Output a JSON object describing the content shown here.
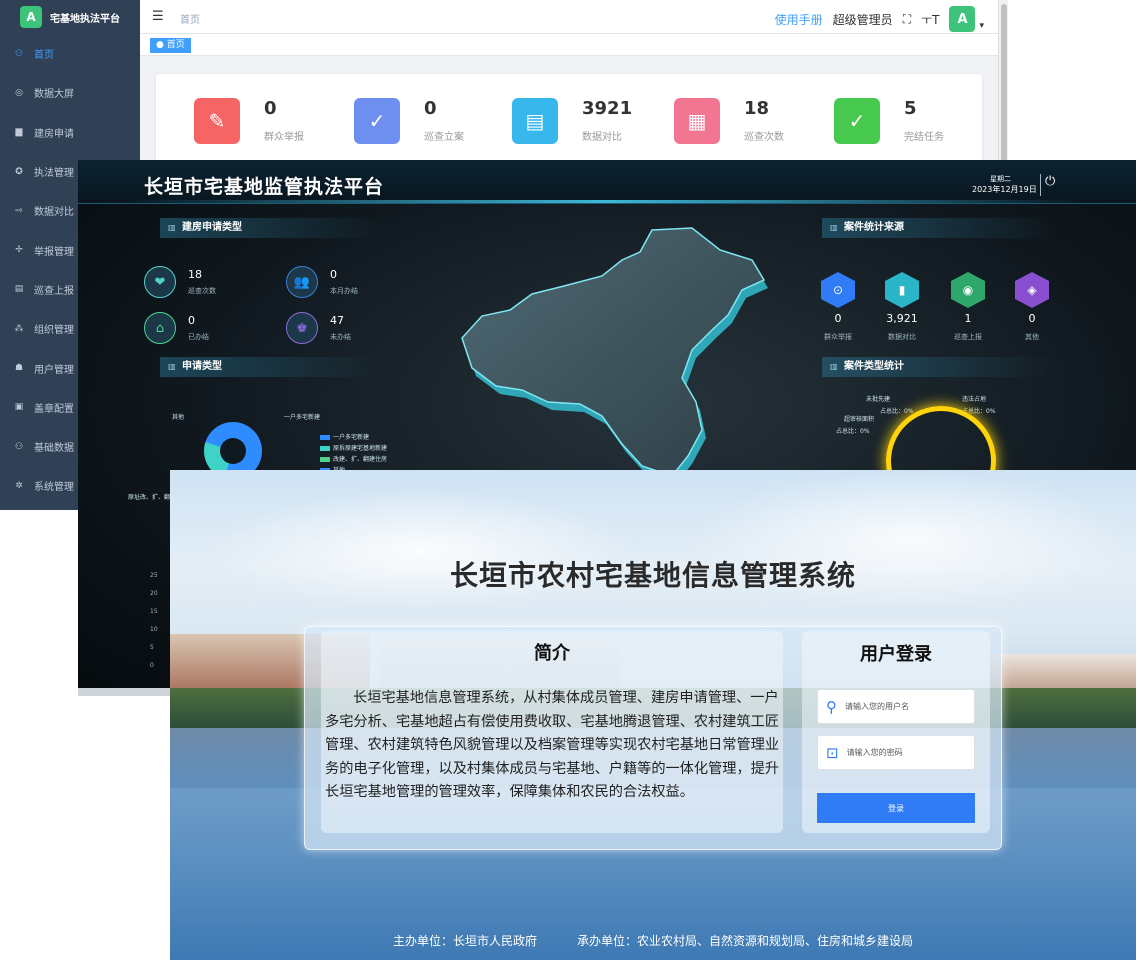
{
  "admin": {
    "logo_char": "A",
    "platform_title": "宅基地执法平台",
    "menu": [
      {
        "icon": "⚇",
        "label": "首页"
      },
      {
        "icon": "◎",
        "label": "数据大屏"
      },
      {
        "icon": "▆",
        "label": "建房申请"
      },
      {
        "icon": "✪",
        "label": "执法管理"
      },
      {
        "icon": "⇨",
        "label": "数据对比"
      },
      {
        "icon": "✢",
        "label": "举报管理"
      },
      {
        "icon": "▤",
        "label": "巡查上报"
      },
      {
        "icon": "⁂",
        "label": "组织管理"
      },
      {
        "icon": "☗",
        "label": "用户管理"
      },
      {
        "icon": "▣",
        "label": "盖章配置"
      },
      {
        "icon": "⚇",
        "label": "基础数据"
      },
      {
        "icon": "✲",
        "label": "系统管理"
      }
    ],
    "breadcrumb": "首页",
    "tag_home": "● 首页",
    "manual_link": "使用手册",
    "user_name": "超级管理员",
    "fullscreen_icon": "⛶",
    "fontsize_icon": "ㅜT",
    "avatar_char": "A",
    "dropdown_icon": "▾",
    "hamburger_icon": "☰",
    "stats": [
      {
        "value": "0",
        "label": "群众举报",
        "color": "#f56565",
        "icon": "✎"
      },
      {
        "value": "0",
        "label": "巡查立案",
        "color": "#6e8ef0",
        "icon": "✓"
      },
      {
        "value": "3921",
        "label": "数据对比",
        "color": "#37b7ec",
        "icon": "▤"
      },
      {
        "value": "18",
        "label": "巡查次数",
        "color": "#f27591",
        "icon": "▦"
      },
      {
        "value": "5",
        "label": "完结任务",
        "color": "#47c84f",
        "icon": "✓"
      }
    ]
  },
  "dashboard": {
    "title": "长垣市宅基地监管执法平台",
    "weekday": "星期二",
    "date": "2023年12月19日",
    "power_icon": "⏻",
    "panel_build_type": "建房申请类型",
    "kpis": [
      {
        "value": "18",
        "label": "巡查次数",
        "color": "#4fd3c9",
        "icon": "❤"
      },
      {
        "value": "0",
        "label": "本月办结",
        "color": "#3a7fd9",
        "icon": "👥"
      },
      {
        "value": "0",
        "label": "已办结",
        "color": "#4fd38a",
        "icon": "⌂"
      },
      {
        "value": "47",
        "label": "未办结",
        "color": "#8b6ad9",
        "icon": "♚"
      }
    ],
    "panel_apply_type": "申请类型",
    "donut_label_left": "其他",
    "donut_label_right": "一户多宅新建",
    "legend": [
      {
        "label": "一户多宅新建",
        "color": "#2f8cff"
      },
      {
        "label": "原拆原建宅基地新建",
        "color": "#3fd2c8"
      },
      {
        "label": "改建、扩、翻建住房",
        "color": "#4fd38a"
      },
      {
        "label": "其他",
        "color": "#2f8cff"
      }
    ],
    "cut_label": "原址改、扩、翻",
    "panel_case_source": "案件统计来源",
    "sources": [
      {
        "value": "0",
        "label": "群众举报",
        "color": "#2f7cf6",
        "icon": "⊙"
      },
      {
        "value": "3,921",
        "label": "数据对比",
        "color": "#2bb5c9",
        "icon": "▮"
      },
      {
        "value": "1",
        "label": "巡查上报",
        "color": "#2ea86a",
        "icon": "◉"
      },
      {
        "value": "0",
        "label": "其他",
        "color": "#8a4fd1",
        "icon": "◈"
      }
    ],
    "panel_case_type": "案件类型统计",
    "annotations": [
      {
        "text": "未批先建"
      },
      {
        "text": "违法占地"
      },
      {
        "text": "占总比：0%"
      },
      {
        "text": "占总比：0%"
      },
      {
        "text": "超审核面积"
      },
      {
        "text": "占总比：0%"
      }
    ],
    "yticks": [
      "25",
      "20",
      "15",
      "10",
      "5",
      "0"
    ]
  },
  "login": {
    "title": "长垣市农村宅基地信息管理系统",
    "intro_heading": "简介",
    "intro_text": "长垣宅基地信息管理系统，从村集体成员管理、建房申请管理、一户多宅分析、宅基地超占有偿使用费收取、宅基地腾退管理、农村建筑工匠管理、农村建筑特色风貌管理以及档案管理等实现农村宅基地日常管理业务的电子化管理，以及村集体成员与宅基地、户籍等的一体化管理，提升长垣宅基地管理的管理效率，保障集体和农民的合法权益。",
    "form_heading": "用户登录",
    "username_placeholder": "请输入您的用户名",
    "password_placeholder": "请输入您的密码",
    "user_icon": "⚲",
    "lock_icon": "⊡",
    "login_button": "登录",
    "footer_host": "主办单位：长垣市人民政府",
    "footer_undertake": "承办单位：农业农村局、自然资源和规划局、住房和城乡建设局"
  }
}
